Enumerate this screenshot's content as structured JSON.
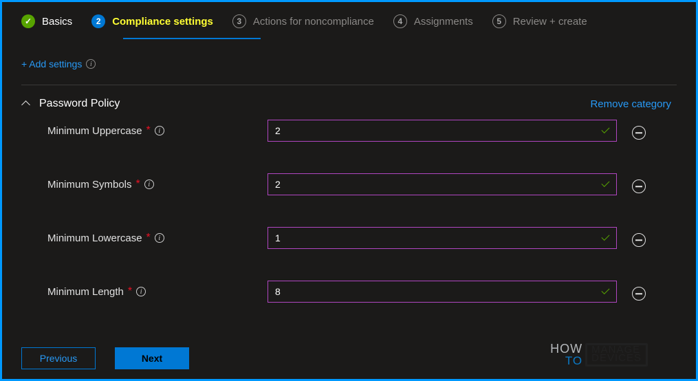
{
  "steps": {
    "s1": {
      "num": "✓",
      "label": "Basics"
    },
    "s2": {
      "num": "2",
      "label": "Compliance settings"
    },
    "s3": {
      "num": "3",
      "label": "Actions for noncompliance"
    },
    "s4": {
      "num": "4",
      "label": "Assignments"
    },
    "s5": {
      "num": "5",
      "label": "Review + create"
    }
  },
  "links": {
    "add_settings": "+ Add settings",
    "remove_category": "Remove category"
  },
  "category": {
    "title": "Password Policy"
  },
  "settings": {
    "uppercase": {
      "label": "Minimum Uppercase",
      "value": "2"
    },
    "symbols": {
      "label": "Minimum Symbols",
      "value": "2"
    },
    "lowercase": {
      "label": "Minimum Lowercase",
      "value": "1"
    },
    "length": {
      "label": "Minimum Length",
      "value": "8"
    }
  },
  "buttons": {
    "previous": "Previous",
    "next": "Next"
  },
  "watermark": {
    "how": "HOW",
    "to": "TO",
    "manage": "MANAGE",
    "devices": "DEVICES"
  }
}
